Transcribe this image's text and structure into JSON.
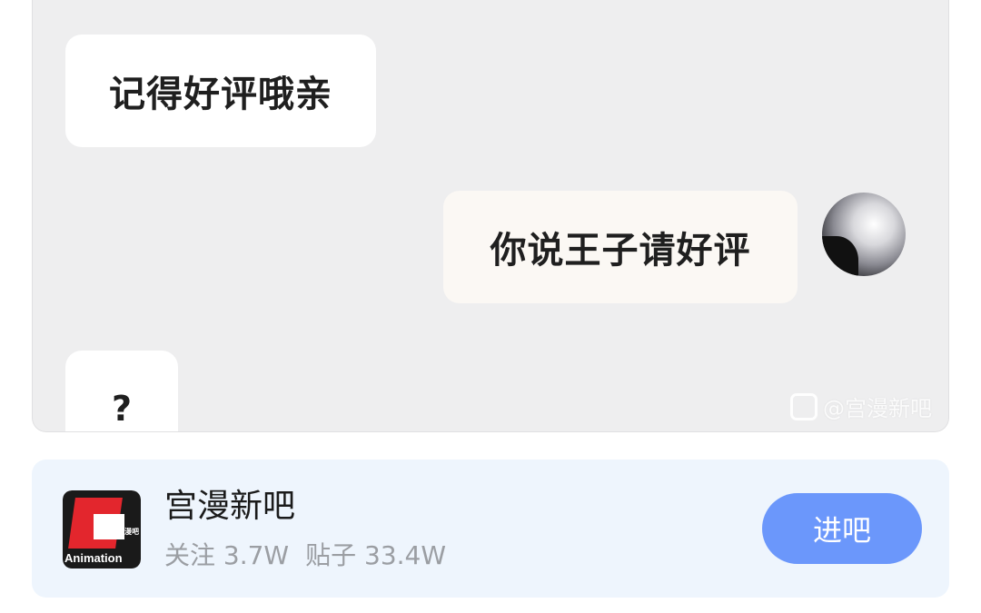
{
  "chat": {
    "bubbles": [
      {
        "text": "记得好评哦亲"
      },
      {
        "text": "你说王子请好评"
      },
      {
        "text": "?"
      }
    ],
    "watermark": "@宫漫新吧"
  },
  "forum": {
    "name": "宫漫新吧",
    "logo_text": "Animation",
    "logo_subtext": "宫漫动漫吧",
    "stats": {
      "followers": "关注 3.7W",
      "posts": "贴子 33.4W"
    },
    "enter_label": "进吧",
    "accent_color": "#6b97fb"
  }
}
